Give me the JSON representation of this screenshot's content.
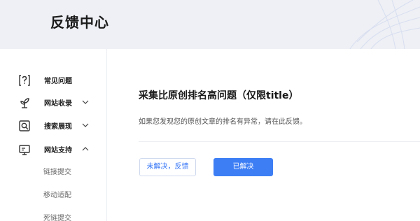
{
  "header": {
    "title": "反馈中心"
  },
  "sidebar": {
    "items": [
      {
        "label": "常见问题",
        "icon": "question-doc-icon"
      },
      {
        "label": "网站收录",
        "icon": "sprout-icon",
        "chevron": "chevron-down-icon"
      },
      {
        "label": "搜索展现",
        "icon": "search-view-icon",
        "chevron": "chevron-down-icon"
      },
      {
        "label": "网站支持",
        "icon": "monitor-icon",
        "chevron": "chevron-up-icon"
      }
    ],
    "subitems": [
      "链接提交",
      "移动适配",
      "死链提交"
    ]
  },
  "main": {
    "question_title": "采集比原创排名高问题（仅限title）",
    "question_desc": "如果您发现您的原创文章的排名有异常，请在此反馈。",
    "unsolved_label": "未解决，反馈",
    "solved_label": "已解决"
  },
  "colors": {
    "accent": "#3d7ef5",
    "header_bg": "#eef0f5",
    "outline_text": "#3072f6"
  }
}
